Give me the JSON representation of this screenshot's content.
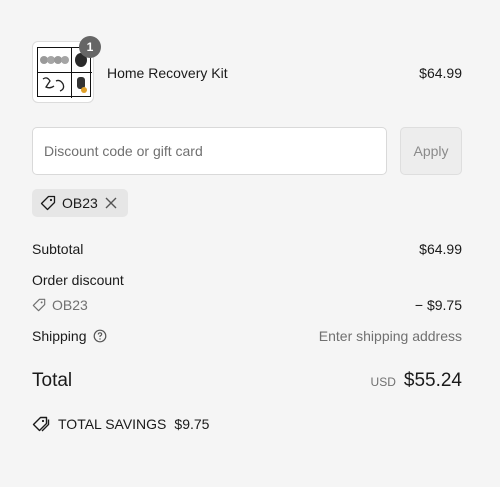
{
  "cart": {
    "quantity": "1",
    "product_name": "Home Recovery Kit",
    "product_price": "$64.99"
  },
  "discount": {
    "placeholder": "Discount code or gift card",
    "apply_label": "Apply",
    "applied_code": "OB23"
  },
  "summary": {
    "subtotal_label": "Subtotal",
    "subtotal_value": "$64.99",
    "order_discount_label": "Order discount",
    "discount_code": "OB23",
    "discount_value": "− $9.75",
    "shipping_label": "Shipping",
    "shipping_value": "Enter shipping address",
    "total_label": "Total",
    "currency": "USD",
    "total_value": "$55.24"
  },
  "savings": {
    "label": "TOTAL SAVINGS",
    "value": "$9.75"
  },
  "icons": {
    "tag": "tag-icon",
    "close": "close-icon",
    "help": "help-circle-icon",
    "savings_tag": "tag-icon"
  }
}
